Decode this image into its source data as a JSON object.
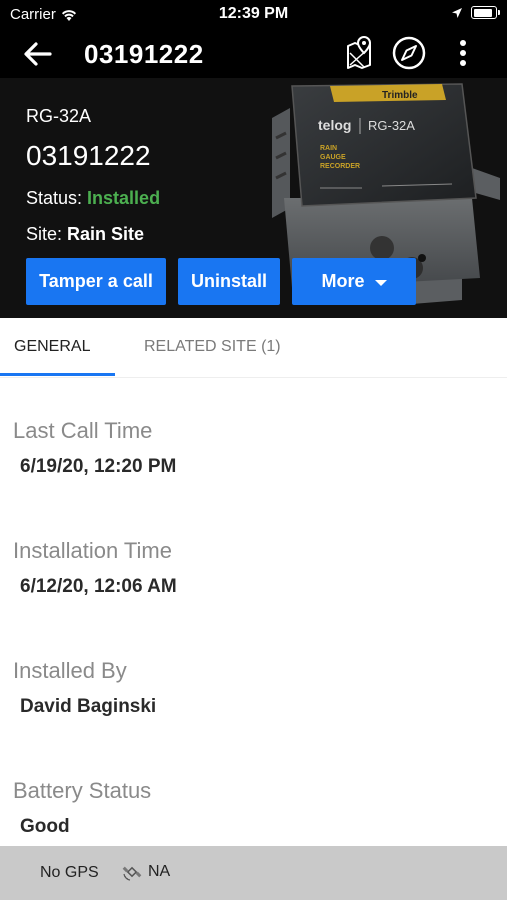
{
  "status_bar": {
    "carrier": "Carrier",
    "time": "12:39 PM",
    "battery_level": 0.9
  },
  "app_bar": {
    "title": "03191222",
    "icons": [
      "back-arrow-icon",
      "map-pin-icon",
      "compass-icon",
      "more-vertical-icon"
    ]
  },
  "header": {
    "model": "RG-32A",
    "serial": "03191222",
    "status_label": "Status:",
    "status_value": "Installed",
    "site_label": "Site:",
    "site_value": "Rain Site",
    "device_image": {
      "brand": "Trimble",
      "logo": "telog",
      "model": "RG-32A",
      "description": [
        "RAIN",
        "GAUGE",
        "RECORDER"
      ]
    },
    "buttons": {
      "tamper": "Tamper a call",
      "uninstall": "Uninstall",
      "more": "More"
    }
  },
  "tabs": [
    {
      "label": "GENERAL",
      "active": true
    },
    {
      "label": "RELATED SITE (1)",
      "active": false
    }
  ],
  "fields": [
    {
      "label": "Last Call Time",
      "value": "6/19/20, 12:20 PM"
    },
    {
      "label": "Installation Time",
      "value": "6/12/20, 12:06 AM"
    },
    {
      "label": "Installed By",
      "value": "David Baginski"
    },
    {
      "label": "Battery Status",
      "value": "Good"
    }
  ],
  "footer": {
    "gps": "No GPS",
    "signal": "NA"
  },
  "colors": {
    "accent": "#1976f2",
    "status_ok": "#4caf50",
    "header_bg": "#111111"
  }
}
